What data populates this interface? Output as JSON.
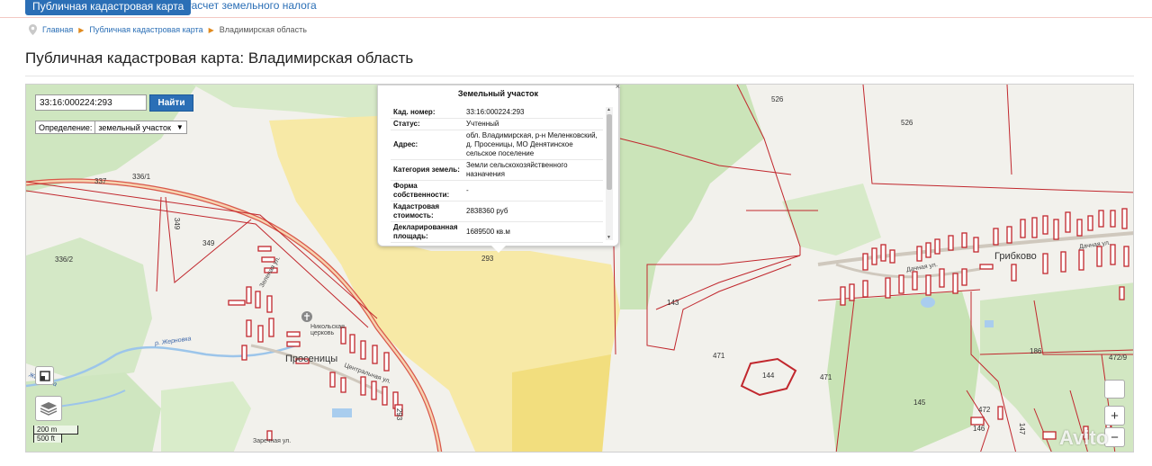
{
  "tabs": {
    "active": "Публичная кадастровая карта",
    "other": "Расчет земельного налога"
  },
  "breadcrumb": {
    "home": "Главная",
    "section": "Публичная кадастровая карта",
    "current": "Владимирская область"
  },
  "page_title": "Публичная кадастровая карта: Владимирская область",
  "search": {
    "value": "33:16:000224:293",
    "button": "Найти"
  },
  "definition": {
    "label": "Определение:",
    "value": "земельный участок"
  },
  "popup": {
    "title": "Земельный участок",
    "rows": [
      {
        "key": "Кад. номер:",
        "value": "33:16:000224:293"
      },
      {
        "key": "Статус:",
        "value": "Учтенный"
      },
      {
        "key": "Адрес:",
        "value": "обл. Владимирская, р-н Меленковский, д. Просеницы, МО Денятинское сельское поселение"
      },
      {
        "key": "Категория земель:",
        "value": "Земли сельскохозяйственного назначения"
      },
      {
        "key": "Форма собственности:",
        "value": "-"
      },
      {
        "key": "Кадастровая стоимость:",
        "value": "2838360 руб"
      },
      {
        "key": "Декларированная площадь:",
        "value": "1689500 кв.м"
      }
    ]
  },
  "map_labels": {
    "l526a": "526",
    "l526b": "526",
    "l337": "337",
    "l336_1": "336/1",
    "l349": "349",
    "l349v": "349",
    "l336_2": "336/2",
    "l293": "293",
    "l143": "143",
    "l471a": "471",
    "l471b": "471",
    "l144": "144",
    "l145": "145",
    "l186": "186",
    "l472_9": "472/9",
    "l472": "472",
    "l146": "146",
    "l147": "147",
    "l293b": "293",
    "village1": "Просеницы",
    "village2": "Грибково",
    "church": "Никольская церковь",
    "street1": "Центральная ул.",
    "street2": "Дачная ул.",
    "street3": "Дачная ул.",
    "street4": "Заречная ул.",
    "street5": "Зеленая ул.",
    "river": "р. Жерновка",
    "river2": "Жерновка"
  },
  "scale": {
    "metric": "200 m",
    "imperial": "500 ft"
  },
  "watermark": "Avito"
}
